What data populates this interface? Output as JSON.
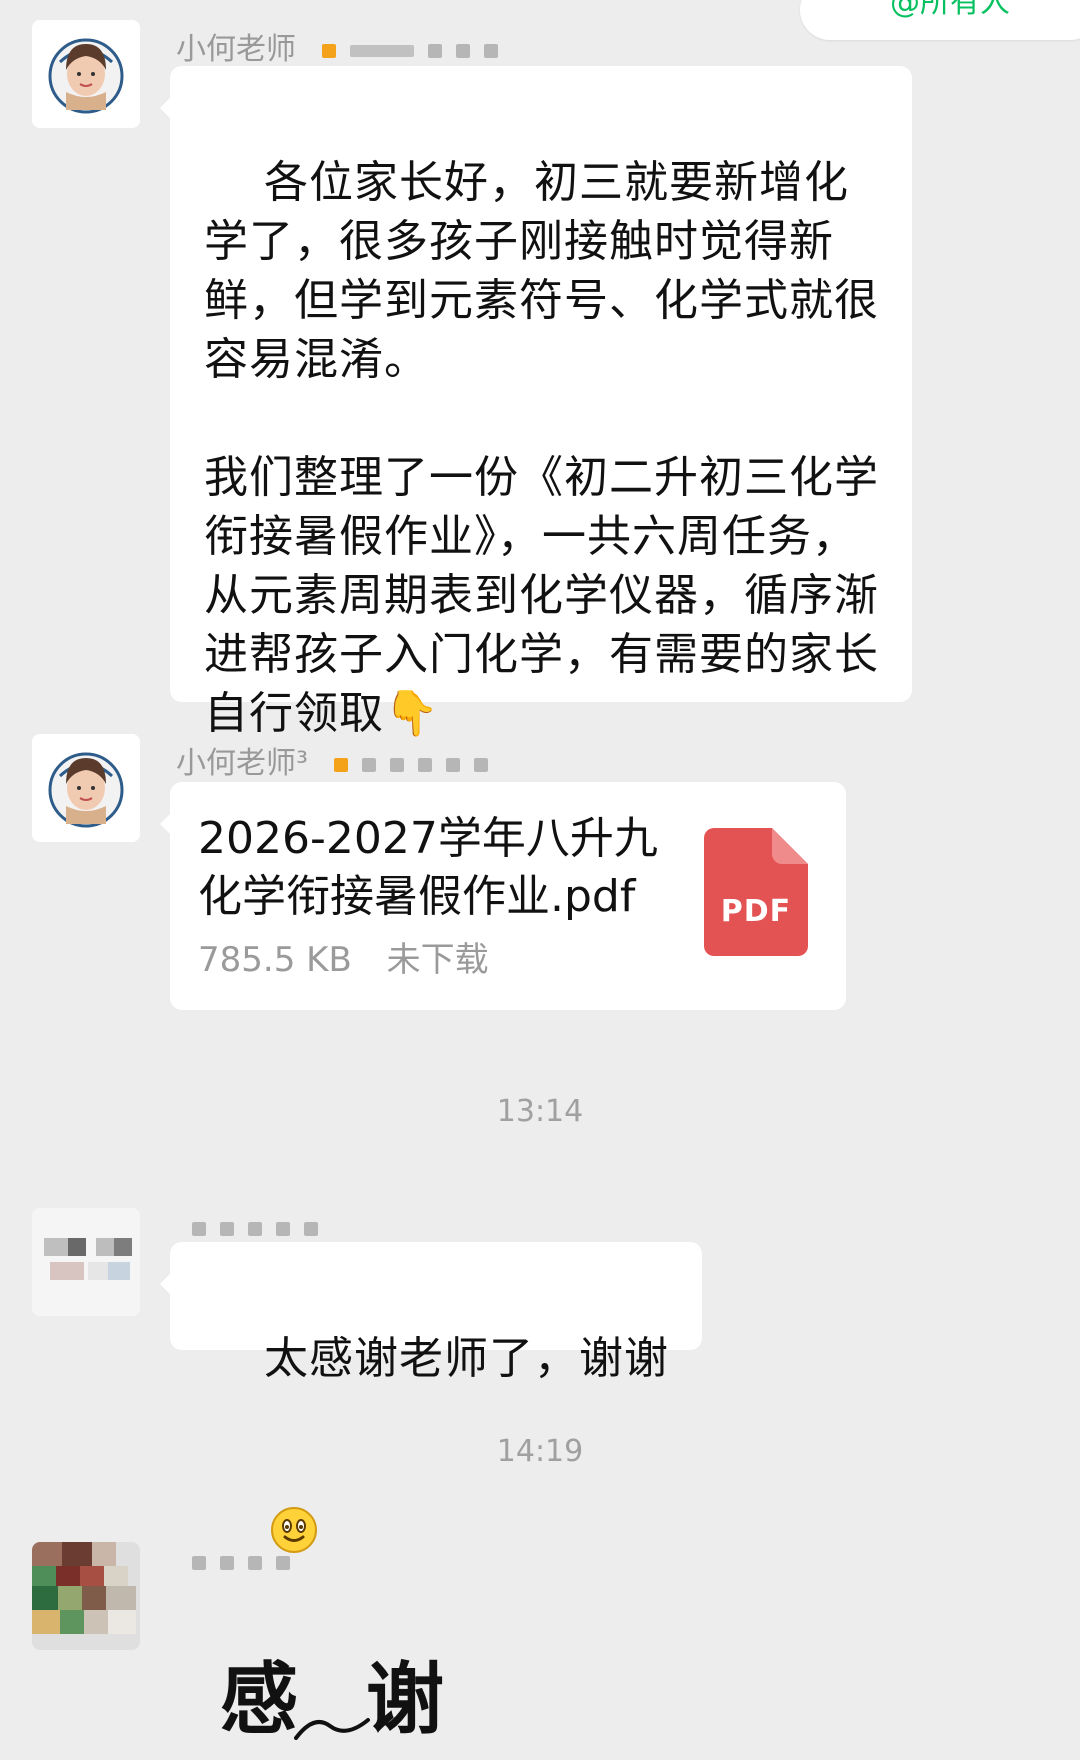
{
  "top_pill_text": "@所有人",
  "messages": [
    {
      "sender": "小何老师",
      "type": "text",
      "text": "各位家长好，初三就要新增化学了，很多孩子刚接触时觉得新鲜，但学到元素符号、化学式就很容易混淆。\n\n我们整理了一份《初二升初三化学衔接暑假作业》，一共六周任务，从元素周期表到化学仪器，循序渐进帮孩子入门化学，有需要的家长自行领取👇"
    },
    {
      "sender": "小何老师³",
      "type": "file",
      "file_name": "2026-2027学年八升九化学衔接暑假作业.pdf",
      "file_size": "785.5 KB",
      "download_status": "未下载",
      "file_type": "PDF"
    }
  ],
  "times": [
    "13:14",
    "14:19"
  ],
  "replies": [
    {
      "type": "text",
      "text": "太感谢老师了，谢谢"
    }
  ],
  "sticker": {
    "char_1": "感",
    "char_2": "谢"
  },
  "colors": {
    "background": "#ededed",
    "bubble": "#ffffff",
    "pdf": "#e45353",
    "time": "#a0a0a0",
    "accent": "#07c160"
  }
}
